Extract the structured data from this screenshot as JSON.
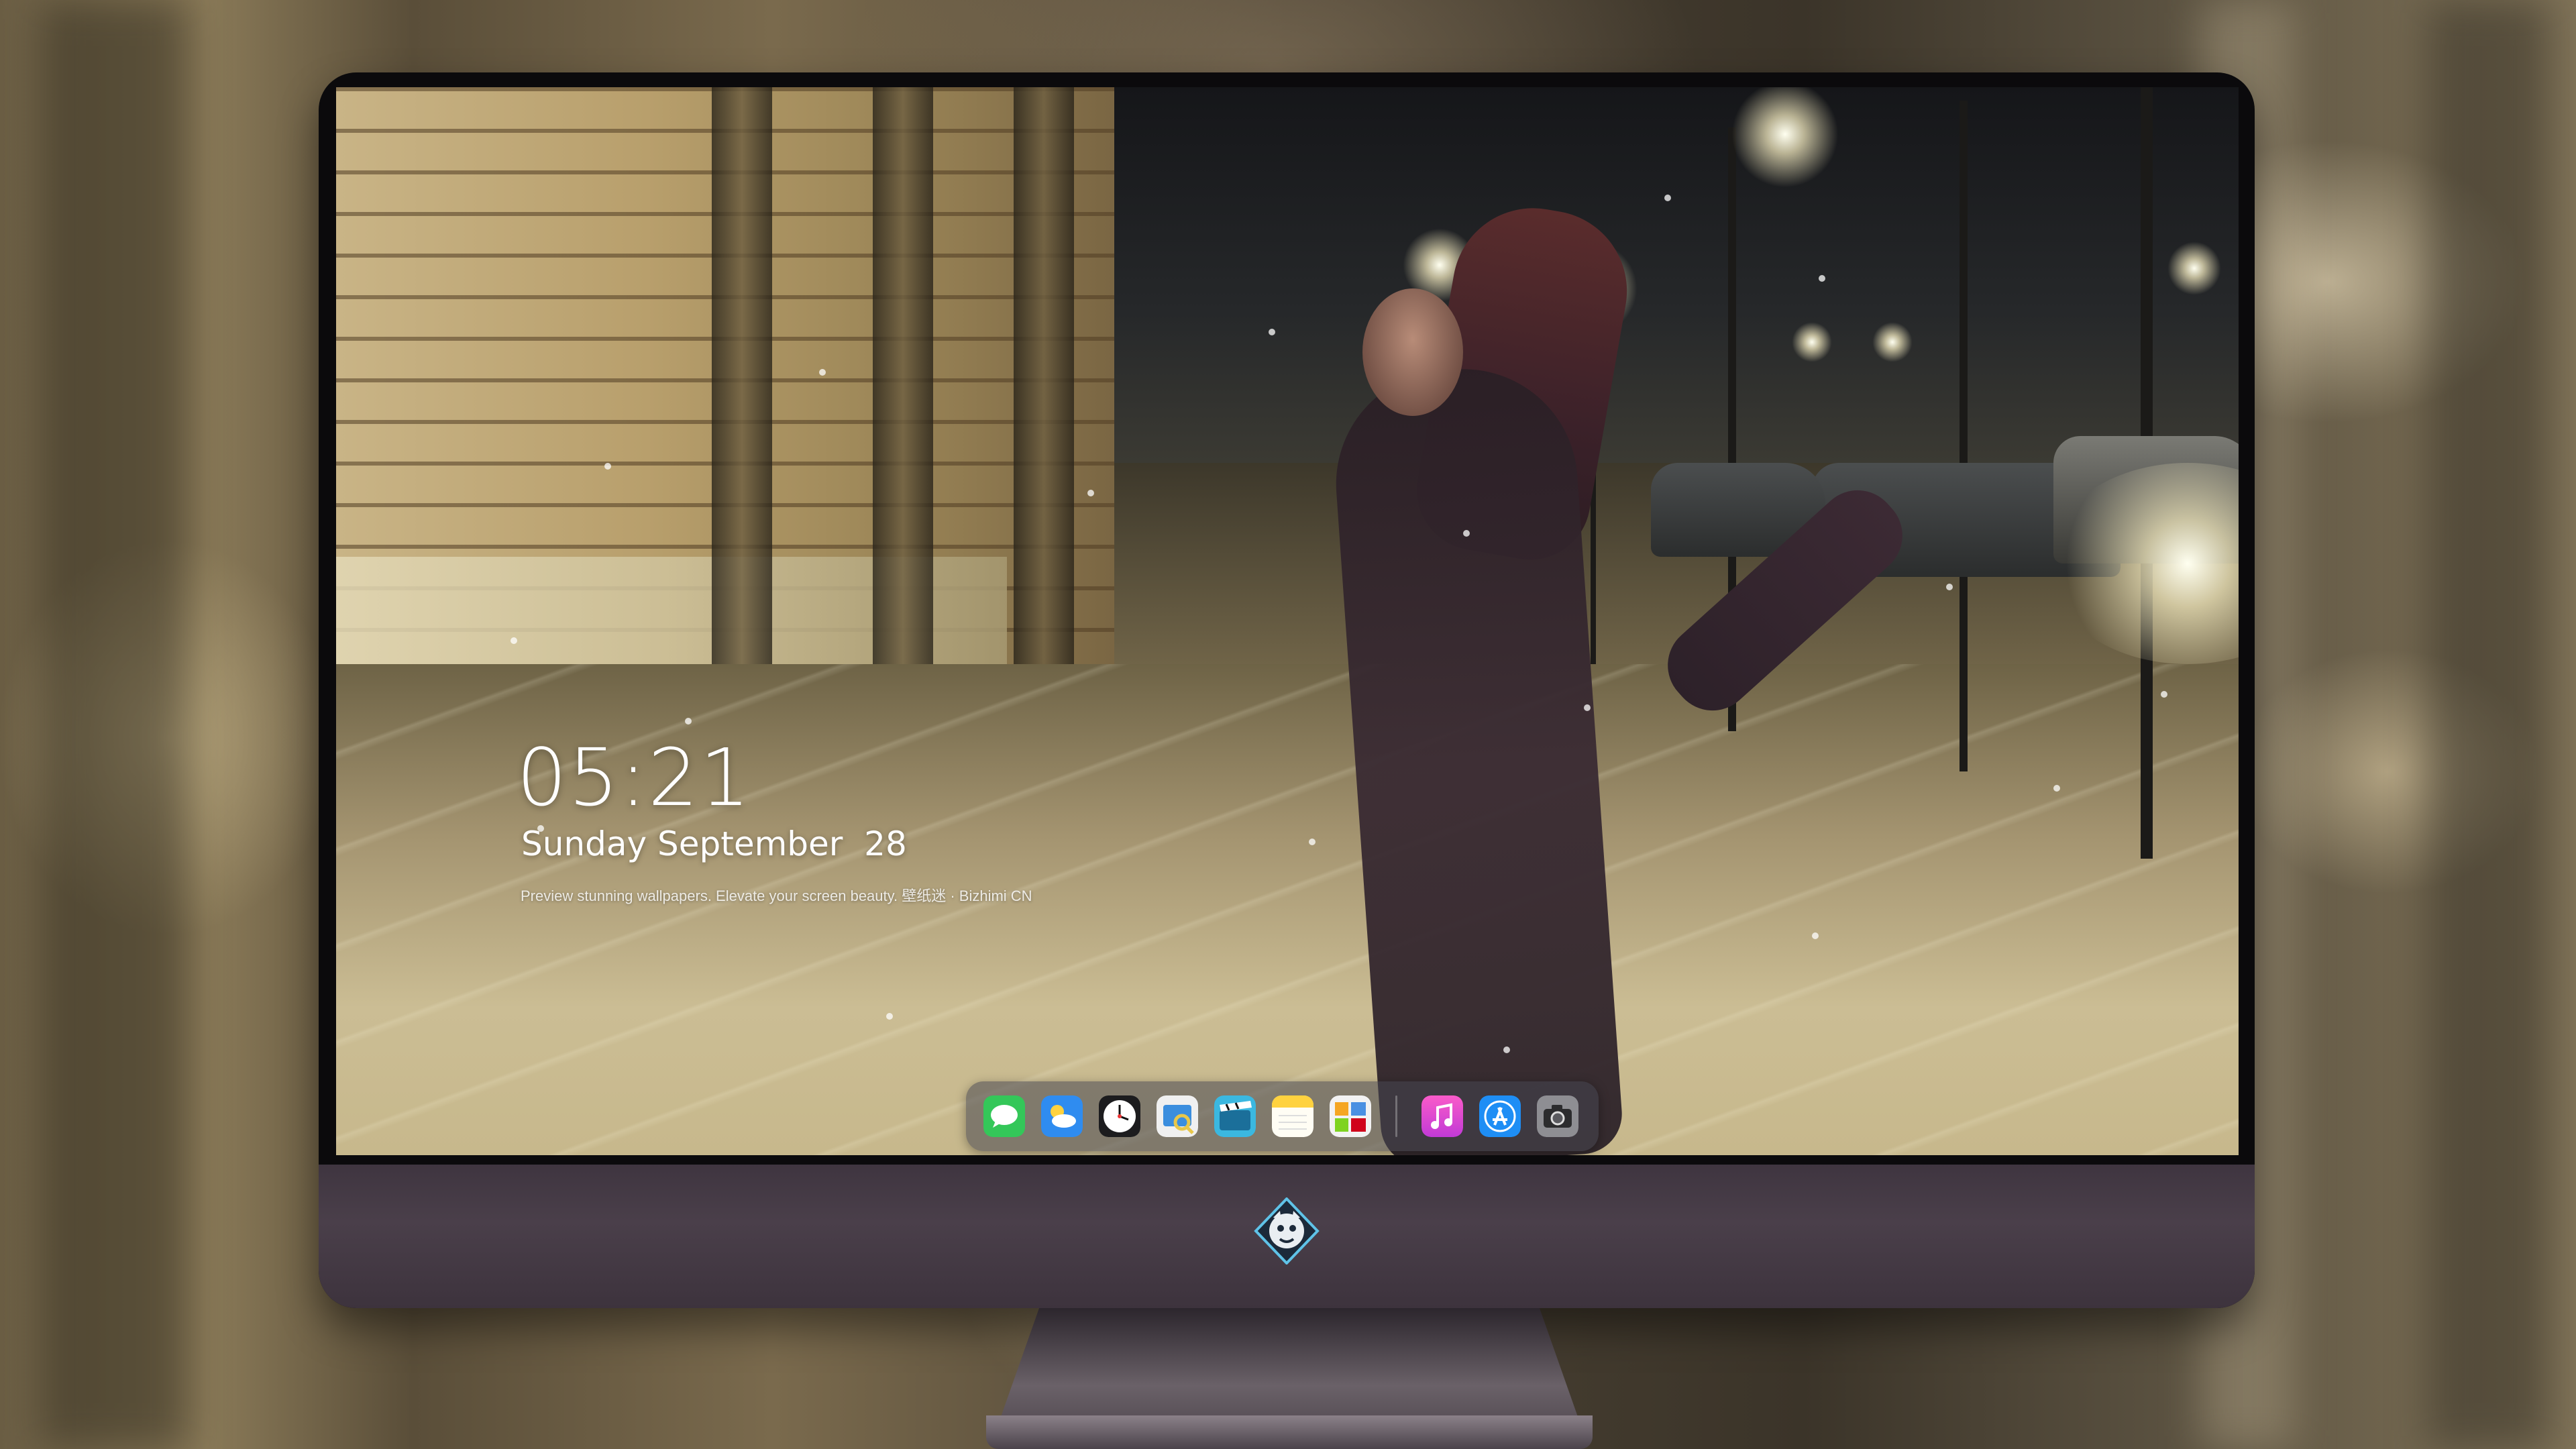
{
  "lockscreen": {
    "time": "05:21",
    "date": "Sunday September  28",
    "tagline": "Preview stunning wallpapers. Elevate your screen beauty. 壁纸迷 · Bizhimi CN"
  },
  "dock": {
    "apps": [
      {
        "name": "messages-icon",
        "color": "#34c759"
      },
      {
        "name": "weather-icon",
        "color": "#2f8cf0"
      },
      {
        "name": "clock-icon",
        "color": "#ffffff"
      },
      {
        "name": "preview-icon",
        "color": "#e8c74a"
      },
      {
        "name": "video-editor-icon",
        "color": "#3bb8e0"
      },
      {
        "name": "notes-icon",
        "color": "#ffd23f"
      },
      {
        "name": "photo-gallery-icon",
        "color": "#f5a623"
      },
      {
        "name": "music-icon",
        "color": "#f24bb3"
      },
      {
        "name": "app-store-icon",
        "color": "#1e8ef5"
      },
      {
        "name": "camera-icon",
        "color": "#8e8e93"
      }
    ]
  },
  "monitor": {
    "logo_icon": "mascot-logo-icon"
  }
}
